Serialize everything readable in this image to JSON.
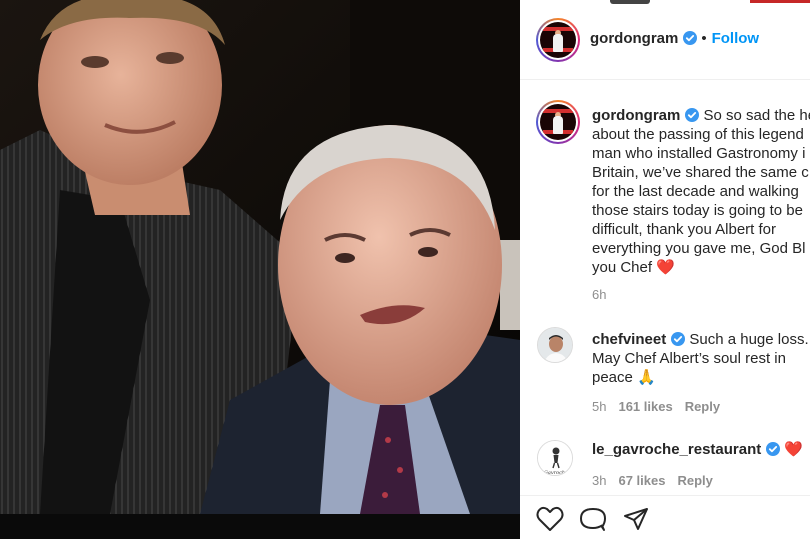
{
  "post": {
    "author": "gordongram",
    "follow_label": "Follow",
    "separator": "•"
  },
  "caption": {
    "username": "gordongram",
    "lines": [
      "So so sad the he",
      "about the passing of this legend",
      "man who installed Gastronomy i",
      "Britain, we’ve shared the same c",
      "for the last decade and walking",
      "those stairs today is going to be",
      "difficult, thank you Albert for",
      "everything you gave me, God Bl",
      "you Chef"
    ],
    "emoji": "❤️",
    "time": "6h"
  },
  "comments": [
    {
      "username": "chefvineet",
      "lines": [
        "Such a huge loss.",
        "May Chef Albert’s soul rest in",
        "peace"
      ],
      "emoji": "🙏",
      "time": "5h",
      "likes": "161 likes",
      "reply": "Reply"
    },
    {
      "username": "le_gavroche_restaurant",
      "emoji": "❤️",
      "time": "3h",
      "likes": "67 likes",
      "reply": "Reply",
      "avatar_text": "Gavroche"
    }
  ],
  "icons": {
    "verified": "verified-badge-icon",
    "like": "heart-icon",
    "comment": "comment-bubble-icon",
    "share": "paper-plane-icon"
  },
  "colors": {
    "link_blue": "#0095f6",
    "verified_blue": "#3897f0",
    "meta_gray": "#8e8e8e"
  }
}
